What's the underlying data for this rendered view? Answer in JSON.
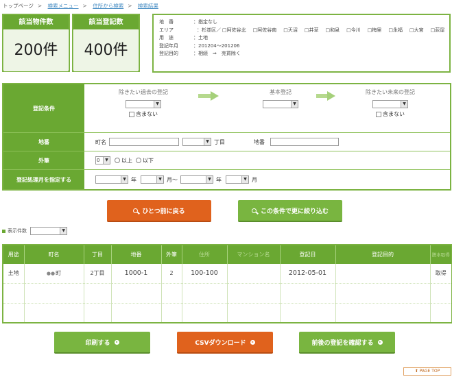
{
  "breadcrumb": {
    "items": [
      "トップページ",
      "検索メニュー",
      "住所から検索",
      "検索結果"
    ]
  },
  "counts": {
    "properties": {
      "label": "該当物件数",
      "value": "200件"
    },
    "registrations": {
      "label": "該当登記数",
      "value": "400件"
    }
  },
  "summary": {
    "chiban_key": "地　番",
    "chiban_val": "：指定なし",
    "area_key": "エリア",
    "area_prefix": "：杉並区／",
    "areas": [
      "阿佐谷北",
      "阿佐谷南",
      "天沼",
      "井草",
      "和泉",
      "今川",
      "梅里",
      "永福",
      "大宮",
      "荻窪"
    ],
    "use_key": "用　途",
    "use_val": "：土地",
    "period_key": "登記年月",
    "period_val": "：201204～201206",
    "purpose_key": "登記目的",
    "purpose_val": "：相続　⇒　売買除く"
  },
  "form": {
    "reg_condition_label": "登記条件",
    "past_header": "除きたい過去の登記",
    "base_header": "基本登記",
    "future_header": "除きたい未来の登記",
    "exclude_label": "含まない",
    "address_label": "地番",
    "town_label": "町名",
    "chome_label": "丁目",
    "chiban_label": "地番",
    "outer_label": "外筆",
    "outer_value": "0",
    "above_label": "以上",
    "below_label": "以下",
    "month_label": "登記処理月を指定する",
    "year_label": "年",
    "month_tilde": "月～",
    "year_label2": "年",
    "month_end": "月"
  },
  "buttons": {
    "back": "ひとつ前に戻る",
    "refine": "この条件で更に絞り込む",
    "print": "印刷する",
    "csv": "CSVダウンロード",
    "check_before_after": "前後の登記を確認する"
  },
  "display_count": {
    "label": "表示件数"
  },
  "table": {
    "headers": [
      "用途",
      "町名",
      "丁目",
      "地番",
      "外筆",
      "住所",
      "マンション名",
      "登記日",
      "登記目的",
      "謄本取得"
    ],
    "rows": [
      {
        "use": "土地",
        "town": "町",
        "chome": "2丁目",
        "chiban": "1000-1",
        "outer": "2",
        "address": "100-100",
        "mansion": "",
        "date": "2012-05-01",
        "purpose": "",
        "action": "取得"
      }
    ]
  },
  "page_top": "PAGE TOP",
  "colors": {
    "green": "#6aa832",
    "orange": "#e0621d"
  }
}
